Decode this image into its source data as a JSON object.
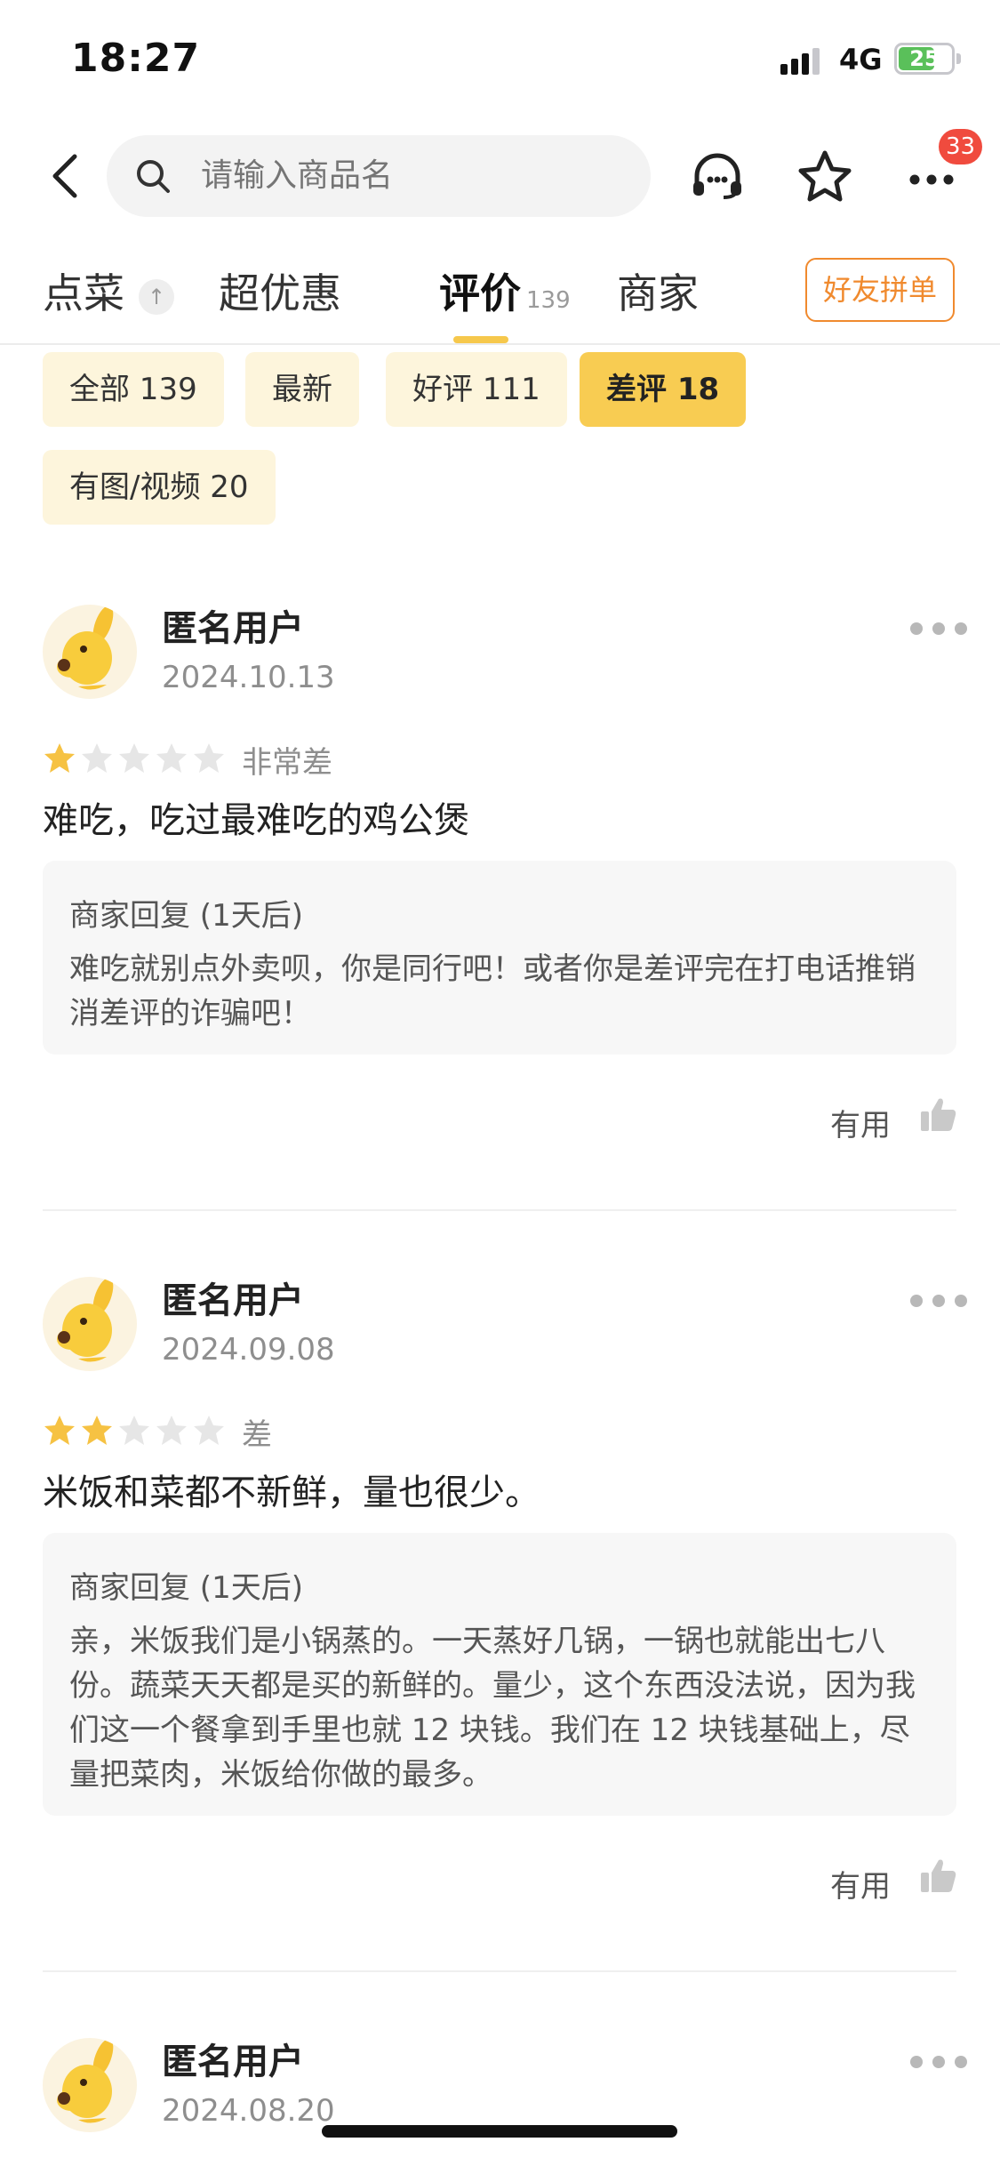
{
  "status_bar": {
    "time": "18:27",
    "network": "4G",
    "battery": "25"
  },
  "search": {
    "placeholder": "请输入商品名"
  },
  "header": {
    "more_badge": "33"
  },
  "tabs": [
    {
      "label": "点菜",
      "pin_icon": "pin-top-icon"
    },
    {
      "label": "超优惠"
    },
    {
      "label": "评价",
      "count": "139",
      "active": true
    },
    {
      "label": "商家"
    }
  ],
  "friend_button": "好友拼单",
  "filters": [
    {
      "label": "全部 139"
    },
    {
      "label": "最新"
    },
    {
      "label": "好评 111"
    },
    {
      "label": "差评 18",
      "active": true
    },
    {
      "label": "有图/视频 20"
    }
  ],
  "reviews": [
    {
      "user": "匿名用户",
      "date": "2024.10.13",
      "rating": 1,
      "rating_text": "非常差",
      "text": "难吃，吃过最难吃的鸡公煲",
      "reply_title": "商家回复 (1天后)",
      "reply_text": "难吃就别点外卖呗，你是同行吧！或者你是差评完在打电话推销消差评的诈骗吧！",
      "useful": "有用"
    },
    {
      "user": "匿名用户",
      "date": "2024.09.08",
      "rating": 2,
      "rating_text": "差",
      "text": "米饭和菜都不新鲜，量也很少。",
      "reply_title": "商家回复 (1天后)",
      "reply_text": "亲，米饭我们是小锅蒸的。一天蒸好几锅，一锅也就能出七八份。蔬菜天天都是买的新鲜的。量少，这个东西没法说，因为我们这一个餐拿到手里也就 12 块钱。我们在 12 块钱基础上，尽量把菜肉，米饭给你做的最多。",
      "useful": "有用"
    },
    {
      "user": "匿名用户",
      "date": "2024.08.20"
    }
  ],
  "colors": {
    "accent": "#f8cc52",
    "filter_bg": "#fdf5dc",
    "star_on": "#f6c243",
    "star_off": "#e6e6e6",
    "friend_btn": "#f08a2e",
    "badge": "#f04b3e"
  }
}
